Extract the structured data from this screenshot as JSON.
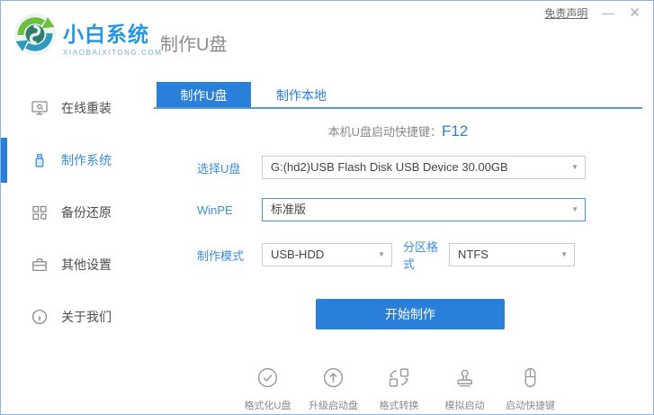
{
  "window": {
    "disclaimer_link": "免责声明",
    "minimize_label": "—",
    "close_label": "✕"
  },
  "brand": {
    "name": "小白系统",
    "domain": "XIAOBAIXITONG.COM"
  },
  "page_title": "制作U盘",
  "sidebar": {
    "items": [
      {
        "label": "在线重装",
        "icon": "monitor-icon",
        "active": false
      },
      {
        "label": "制作系统",
        "icon": "usb-drive-icon",
        "active": true
      },
      {
        "label": "备份还原",
        "icon": "grid-squares-icon",
        "active": false
      },
      {
        "label": "其他设置",
        "icon": "toolbox-icon",
        "active": false
      },
      {
        "label": "关于我们",
        "icon": "info-circle-icon",
        "active": false
      }
    ]
  },
  "tabs": {
    "tab1": "制作U盘",
    "tab2": "制作本地"
  },
  "hotkey": {
    "label": "本机U盘启动快捷键：",
    "value": "F12"
  },
  "form": {
    "usb": {
      "label": "选择U盘",
      "value": "G:(hd2)USB Flash Disk USB Device 30.00GB"
    },
    "winpe": {
      "label": "WinPE",
      "value": "标准版"
    },
    "mode": {
      "label": "制作模式",
      "value": "USB-HDD"
    },
    "partition": {
      "label": "分区格式",
      "value": "NTFS"
    },
    "start_button": "开始制作"
  },
  "toolbar": {
    "items": [
      {
        "label": "格式化U盘",
        "icon": "check-circle-icon"
      },
      {
        "label": "升级启动盘",
        "icon": "arrow-up-circle-icon"
      },
      {
        "label": "格式转换",
        "icon": "convert-squares-icon"
      },
      {
        "label": "模拟启动",
        "icon": "stamp-icon"
      },
      {
        "label": "启动快捷键",
        "icon": "mouse-icon"
      }
    ]
  },
  "icons": {
    "dropdown_caret": "▼"
  },
  "colors": {
    "primary": "#2a7fd8",
    "brand_blue": "#2596e4",
    "tab_underline": "#5b9bd5",
    "window_border": "#8ab5e8",
    "focus_border": "#4a90e2"
  }
}
